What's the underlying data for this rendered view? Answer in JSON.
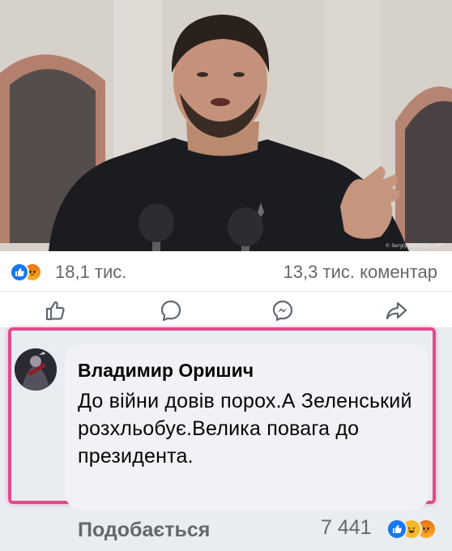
{
  "photo": {
    "credit": "© Sergiy Supinsky / AFP"
  },
  "stats": {
    "reaction_icons": [
      "like-icon",
      "angry-icon"
    ],
    "reaction_count": "18,1 тис.",
    "comment_count": "13,3 тис. коментар"
  },
  "actions": {
    "icons": [
      "like-icon",
      "comment-icon",
      "messenger-icon",
      "share-icon"
    ]
  },
  "comment": {
    "author": "Владимир Оришич",
    "text": "До війни довів порох.А Зеленський розхльобує.Велика повага до президента.",
    "like_label": "Подобається",
    "reaction_count": "7 441",
    "reaction_icons": [
      "like-icon",
      "haha-icon",
      "angry-icon"
    ]
  },
  "colors": {
    "highlight": "#e34a8c",
    "facebook_blue": "#1877f2",
    "muted_text": "#65676b"
  }
}
